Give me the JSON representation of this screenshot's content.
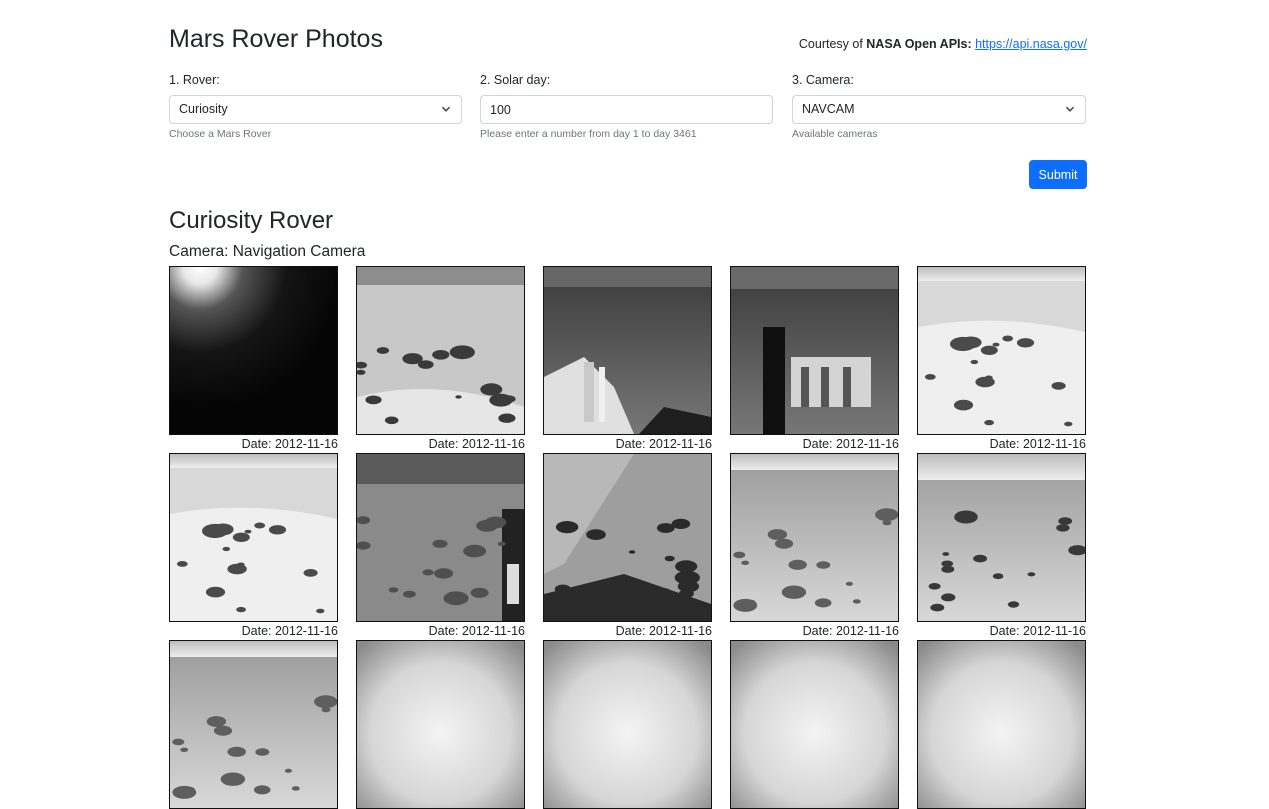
{
  "header": {
    "title": "Mars Rover Photos",
    "courtesy_prefix": "Courtesy of ",
    "courtesy_bold": "NASA Open APIs:",
    "api_link": "https://api.nasa.gov/"
  },
  "form": {
    "rover": {
      "label": "1. Rover:",
      "value": "Curiosity",
      "help": "Choose a Mars Rover"
    },
    "sol": {
      "label": "2. Solar day:",
      "value": "100",
      "help": "Please enter a number from day 1 to day 3461"
    },
    "camera": {
      "label": "3. Camera:",
      "value": "NAVCAM",
      "help": "Available cameras"
    },
    "submit_label": "Submit"
  },
  "results": {
    "rover_title": "Curiosity Rover",
    "camera_title": "Camera: Navigation Camera",
    "photos": [
      {
        "date": "Date: 2012-11-16",
        "style": "sunburst"
      },
      {
        "date": "Date: 2012-11-16",
        "style": "rocky-bright"
      },
      {
        "date": "Date: 2012-11-16",
        "style": "rover-deck"
      },
      {
        "date": "Date: 2012-11-16",
        "style": "rover-mast"
      },
      {
        "date": "Date: 2012-11-16",
        "style": "bright-terrain"
      },
      {
        "date": "Date: 2012-11-16",
        "style": "bright-terrain"
      },
      {
        "date": "Date: 2012-11-16",
        "style": "horizon-dark"
      },
      {
        "date": "Date: 2012-11-16",
        "style": "rocky-slope"
      },
      {
        "date": "Date: 2012-11-16",
        "style": "horizon-gray"
      },
      {
        "date": "Date: 2012-11-16",
        "style": "horizon-rocks"
      },
      {
        "date": "",
        "style": "horizon-gray"
      },
      {
        "date": "",
        "style": "vignette"
      },
      {
        "date": "",
        "style": "vignette"
      },
      {
        "date": "",
        "style": "vignette"
      },
      {
        "date": "",
        "style": "vignette"
      }
    ]
  },
  "colors": {
    "primary": "#0d6efd",
    "text": "#212529",
    "muted": "#6c757d",
    "border": "#ced4da"
  }
}
